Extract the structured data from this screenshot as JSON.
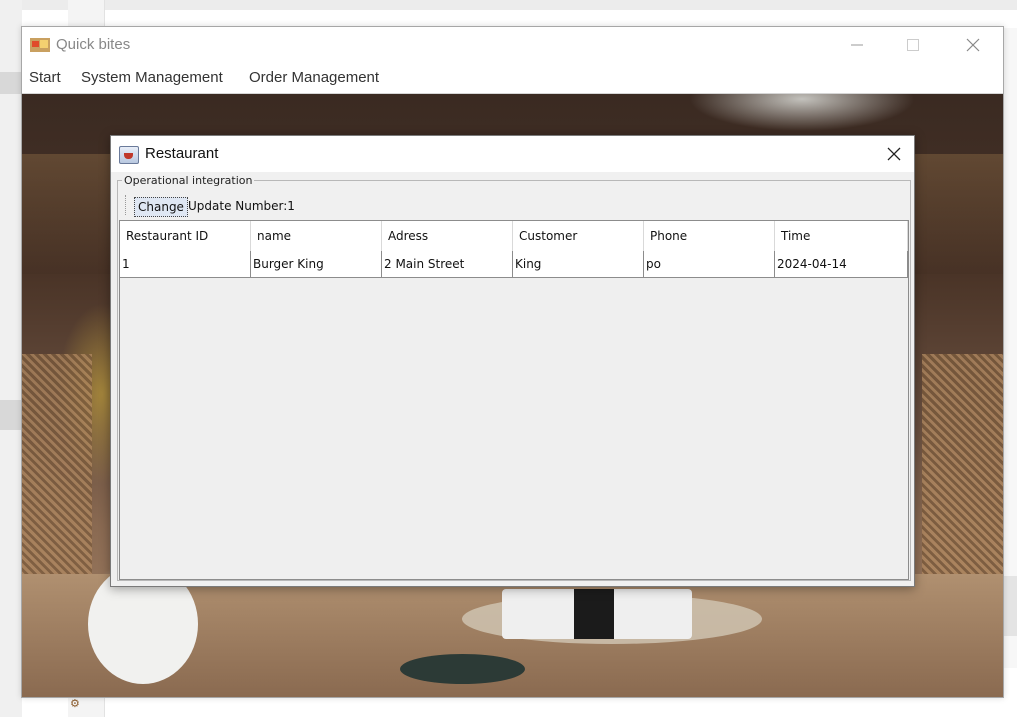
{
  "main_window": {
    "title": "Quick bites",
    "menu": [
      "Start",
      "System Management",
      "Order Management"
    ]
  },
  "dialog": {
    "title": "Restaurant",
    "group_label": "Operational integration",
    "change_label": "Change",
    "update_label": "Update Number:1",
    "table": {
      "columns": [
        "Restaurant ID",
        "name",
        "Adress",
        "Customer",
        "Phone",
        "Time"
      ],
      "rows": [
        [
          "1",
          "Burger King",
          "2 Main Street",
          "King",
          "po",
          "2024-04-14"
        ]
      ]
    }
  },
  "colors": {
    "accent": "#dfe7f3",
    "title_inactive": "#888888"
  }
}
